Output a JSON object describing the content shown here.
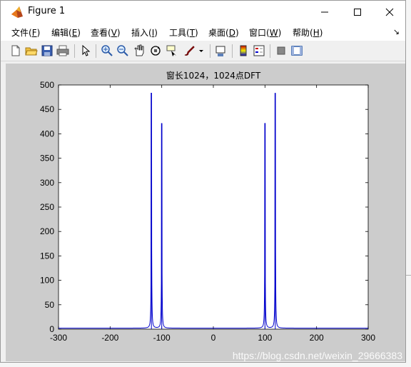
{
  "window": {
    "title": "Figure 1"
  },
  "menu": [
    {
      "label": "文件(",
      "key": "F",
      "tail": ")"
    },
    {
      "label": "编辑(",
      "key": "E",
      "tail": ")"
    },
    {
      "label": "查看(",
      "key": "V",
      "tail": ")"
    },
    {
      "label": "插入(",
      "key": "I",
      "tail": ")"
    },
    {
      "label": "工具(",
      "key": "T",
      "tail": ")"
    },
    {
      "label": "桌面(",
      "key": "D",
      "tail": ")"
    },
    {
      "label": "窗口(",
      "key": "W",
      "tail": ")"
    },
    {
      "label": "帮助(",
      "key": "H",
      "tail": ")"
    }
  ],
  "toolbar": [
    "new-figure-icon",
    "open-file-icon",
    "save-icon",
    "print-icon",
    "pointer-icon",
    "zoom-in-icon",
    "zoom-out-icon",
    "pan-icon",
    "rotate-3d-icon",
    "data-cursor-icon",
    "brush-icon",
    "link-plot-icon",
    "colorbar-icon",
    "legend-icon",
    "hide-plot-tools-icon",
    "show-plot-tools-icon"
  ],
  "watermark": "https://blog.csdn.net/weixin_29666383",
  "chart_data": {
    "type": "line",
    "title": "窗长1024，1024点DFT",
    "xlabel": "",
    "ylabel": "",
    "xlim": [
      -300,
      300
    ],
    "ylim": [
      0,
      500
    ],
    "xticks": [
      -300,
      -200,
      -100,
      0,
      100,
      200,
      300
    ],
    "yticks": [
      0,
      50,
      100,
      150,
      200,
      250,
      300,
      350,
      400,
      450,
      500
    ],
    "grid": false,
    "color": "#0000cc",
    "peaks": [
      {
        "x": -120,
        "y": 483
      },
      {
        "x": -100,
        "y": 421
      },
      {
        "x": 100,
        "y": 421
      },
      {
        "x": 120,
        "y": 483
      }
    ],
    "baseline": 2
  }
}
